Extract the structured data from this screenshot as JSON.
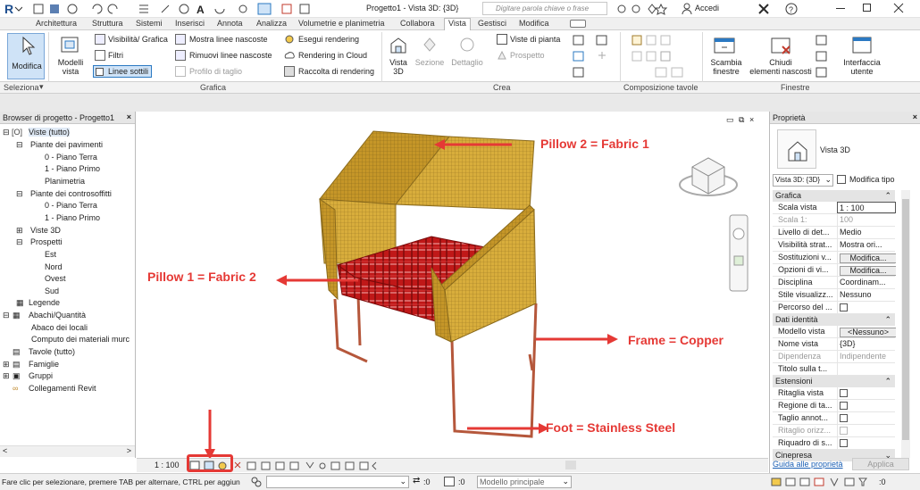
{
  "titlebar": {
    "doc_title": "Progetto1 - Vista 3D: {3D}",
    "search_placeholder": "Digitare parola chiave o frase",
    "accedi": "Accedi"
  },
  "tabs": [
    "Architettura",
    "Struttura",
    "Sistemi",
    "Inserisci",
    "Annota",
    "Analizza",
    "Volumetrie e planimetria",
    "Collabora",
    "Vista",
    "Gestisci",
    "Modifica"
  ],
  "active_tab": "Vista",
  "ribbon": {
    "modifica": "Modifica",
    "modelli_vista": "Modelli\nvista",
    "grafica_items": [
      "Visibilità/ Grafica",
      "Filtri",
      "Linee sottili",
      "Mostra linee nascoste",
      "Rimuovi linee nascoste",
      "Profilo di taglio",
      "Esegui rendering",
      "Rendering  in Cloud",
      "Raccolta  di rendering"
    ],
    "crea_big": [
      "Vista\n3D",
      "Sezione",
      "Dettaglio"
    ],
    "crea_items": [
      "Viste di pianta",
      "Prospetto"
    ],
    "scambia": "Scambia\nfinestre",
    "chiudi": "Chiudi\nelementi nascosti",
    "interfaccia": "Interfaccia\nutente"
  },
  "panels": {
    "seleziona": "Seleziona",
    "grafica": "Grafica",
    "crea": "Crea",
    "composizione": "Composizione tavole",
    "finestre": "Finestre"
  },
  "browser": {
    "title": "Browser di progetto - Progetto1",
    "items": [
      "Viste (tutto)",
      "Piante dei pavimenti",
      "0 - Piano Terra",
      "1 - Piano Primo",
      "Planimetria",
      "Piante dei controsoffitti",
      "0 - Piano Terra",
      "1 - Piano Primo",
      "Viste 3D",
      "Prospetti",
      "Est",
      "Nord",
      "Ovest",
      "Sud",
      "Legende",
      "Abachi/Quantità",
      "Abaco dei locali",
      "Computo dei materiali murc",
      "Tavole (tutto)",
      "Famiglie",
      "Gruppi",
      "Collegamenti Revit"
    ]
  },
  "annotations": {
    "pillow2": "Pillow 2 = Fabric 1",
    "pillow1": "Pillow 1 = Fabric 2",
    "frame": "Frame = Copper",
    "foot": "Foot = Stainless Steel"
  },
  "properties": {
    "title": "Proprietà",
    "type_name": "Vista 3D",
    "type_select": "Vista 3D: {3D}",
    "modifica_tipo": "Modifica tipo",
    "group_grafica": "Grafica",
    "rows_grafica": [
      [
        "Scala vista",
        "1 : 100"
      ],
      [
        "Scala 1:",
        "100"
      ],
      [
        "Livello di det...",
        "Medio"
      ],
      [
        "Visibilità strat...",
        "Mostra ori..."
      ],
      [
        "Sostituzioni v...",
        "Modifica..."
      ],
      [
        "Opzioni di vi...",
        "Modifica..."
      ],
      [
        "Disciplina",
        "Coordinam..."
      ],
      [
        "Stile visualizz...",
        "Nessuno"
      ],
      [
        "Percorso del ...",
        ""
      ]
    ],
    "group_identita": "Dati identità",
    "rows_identita": [
      [
        "Modello vista",
        "<Nessuno>"
      ],
      [
        "Nome vista",
        "{3D}"
      ],
      [
        "Dipendenza",
        "Indipendente"
      ],
      [
        "Titolo sulla t...",
        ""
      ]
    ],
    "group_estensioni": "Estensioni",
    "rows_estensioni": [
      [
        "Ritaglia vista",
        ""
      ],
      [
        "Regione di ta...",
        ""
      ],
      [
        "Taglio annot...",
        ""
      ],
      [
        "Ritaglio orizz...",
        ""
      ],
      [
        "Riquadro di s...",
        ""
      ]
    ],
    "group_cinepresa": "Cinepresa",
    "link": "Guida alle proprietà",
    "applica": "Applica"
  },
  "viewcontrol": {
    "scale": "1 : 100"
  },
  "status": {
    "message": "Fare clic per selezionare, premere TAB per alternare, CTRL per aggiun",
    "zero1": ":0",
    "zero2": ":0",
    "model": "Modello principale"
  },
  "colors": {
    "accent": "#2b79c2",
    "annotation": "#e53935",
    "fabric_yellow": "#d4a935",
    "fabric_red": "#c01818",
    "copper": "#b5573b"
  }
}
